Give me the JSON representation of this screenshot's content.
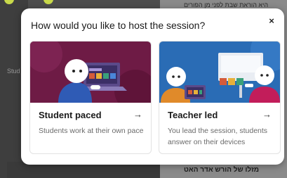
{
  "background": {
    "top_text": "היא הוראת שבת לפני מן הפורים",
    "bottom_text": "מזלו של הורש אדר האט",
    "side_label": "Stud"
  },
  "modal": {
    "title": "How would you like to host the session?",
    "close_glyph": "×"
  },
  "cards": [
    {
      "title": "Student paced",
      "arrow": "→",
      "description": "Students work at their own pace",
      "art_bg": "#6e1b45"
    },
    {
      "title": "Teacher led",
      "arrow": "→",
      "description": "You lead the session, students answer on their devices",
      "art_bg": "#2a6cb5"
    }
  ]
}
